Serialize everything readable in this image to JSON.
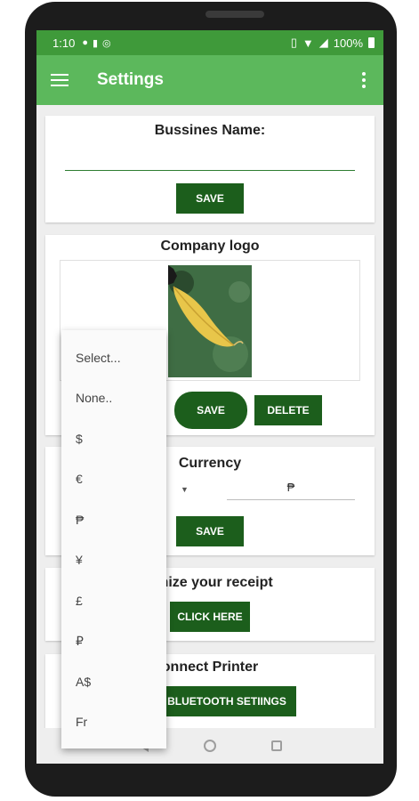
{
  "status_bar": {
    "time": "1:10",
    "battery": "100%",
    "left_icons": [
      "chat-icon",
      "sim-icon",
      "data-saver-icon"
    ],
    "right_icons": [
      "vibrate-icon",
      "wifi-icon",
      "signal-icon",
      "battery-icon"
    ]
  },
  "app_bar": {
    "title": "Settings",
    "colors": {
      "app_bar": "#5cb85c",
      "status_bar": "#3f9a3a"
    }
  },
  "business": {
    "label": "Bussines Name:",
    "value": "",
    "save_label": "SAVE"
  },
  "logo": {
    "label": "Company logo",
    "save_label": "SAVE",
    "delete_label": "DELETE"
  },
  "currency": {
    "label": "Currency",
    "symbol_value": "₱",
    "save_label": "SAVE"
  },
  "receipt": {
    "label": "omize your receipt",
    "button_label": "CLICK HERE"
  },
  "printer": {
    "label": "onnect Printer",
    "button_label": "BLUETOOTH SETIINGS"
  },
  "dropdown": {
    "options": [
      "Select...",
      "None..",
      "$",
      "€",
      "₱",
      "¥",
      "£",
      "₽",
      "A$",
      "Fr"
    ]
  },
  "accent_color": "#1c5e1c"
}
